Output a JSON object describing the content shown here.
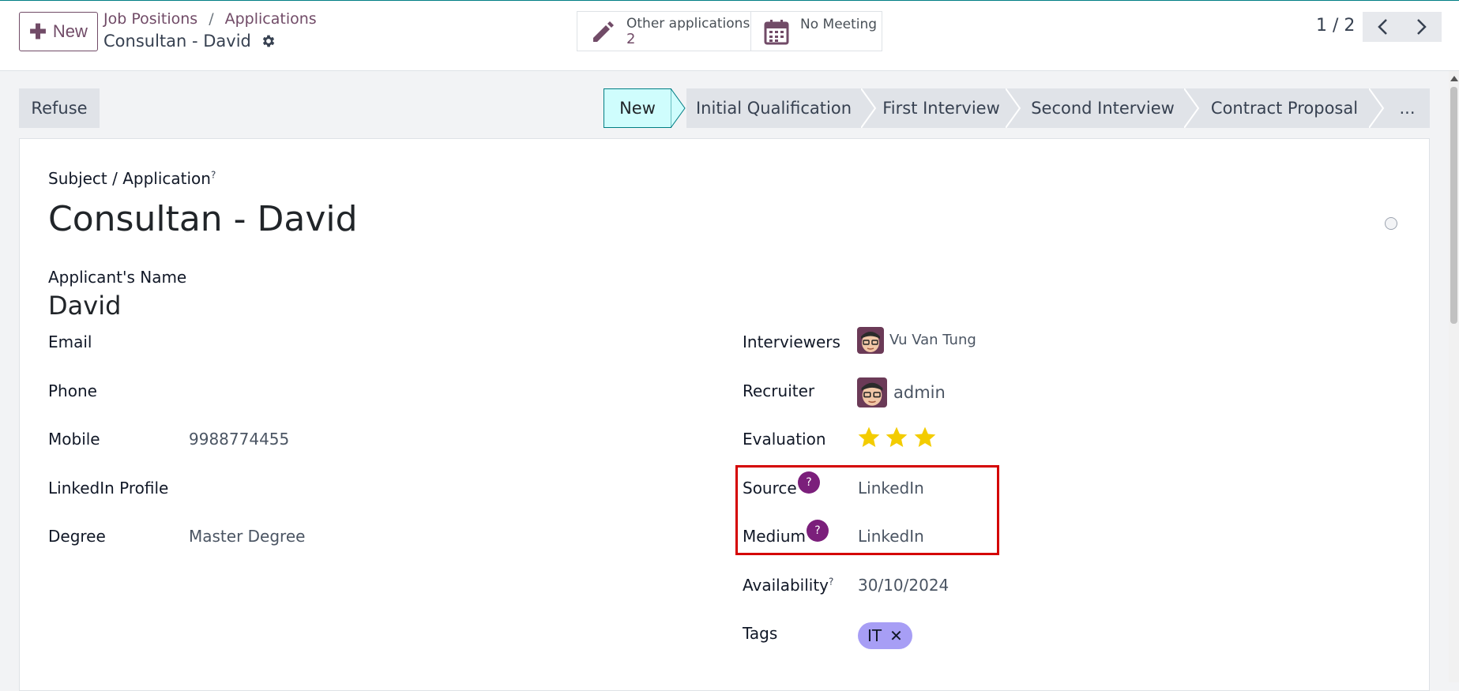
{
  "header": {
    "new_label": "New",
    "breadcrumb": {
      "parent": "Job Positions",
      "separator": "/",
      "current": "Applications"
    },
    "record_title": "Consultan - David",
    "stats": {
      "other_applications": {
        "label": "Other applications",
        "count": "2"
      },
      "meeting": {
        "label": "No Meeting"
      }
    },
    "pager": {
      "text": "1 / 2"
    }
  },
  "statusbar": {
    "refuse_label": "Refuse",
    "stages": [
      "New",
      "Initial Qualification",
      "First Interview",
      "Second Interview",
      "Contract Proposal",
      "..."
    ],
    "active_stage": "New"
  },
  "form": {
    "subject_label": "Subject / Application",
    "subject_help": "?",
    "subject_value": "Consultan - David",
    "applicant_label": "Applicant's Name",
    "applicant_value": "David",
    "left_fields": {
      "email": {
        "label": "Email",
        "value": ""
      },
      "phone": {
        "label": "Phone",
        "value": ""
      },
      "mobile": {
        "label": "Mobile",
        "value": "9988774455"
      },
      "linkedin": {
        "label": "LinkedIn Profile",
        "value": ""
      },
      "degree": {
        "label": "Degree",
        "value": "Master Degree"
      }
    },
    "right_fields": {
      "interviewers": {
        "label": "Interviewers",
        "value": "Vu Van Tung"
      },
      "recruiter": {
        "label": "Recruiter",
        "value": "admin"
      },
      "evaluation": {
        "label": "Evaluation",
        "stars": 3,
        "max_stars": 3
      },
      "source": {
        "label": "Source",
        "help": "?",
        "value": "LinkedIn"
      },
      "medium": {
        "label": "Medium",
        "help": "?",
        "value": "LinkedIn"
      },
      "availability": {
        "label": "Availability",
        "help": "?",
        "value": "30/10/2024"
      },
      "tags": {
        "label": "Tags",
        "items": [
          "IT"
        ],
        "remove_glyph": "✕"
      }
    }
  },
  "colors": {
    "brand": "#714b67",
    "active_stage_bg": "#cffdfd",
    "active_stage_border": "#017e84",
    "highlight": "#d40000",
    "tag_bg": "#a79ef5",
    "star": "#f3cc00",
    "help_badge": "#7b1f7b"
  },
  "icons": {
    "new": "plus-icon",
    "gear": "gear-icon",
    "other_applications": "pencil-icon",
    "meeting": "calendar-icon",
    "pager_prev": "chevron-left-icon",
    "pager_next": "chevron-right-icon"
  }
}
